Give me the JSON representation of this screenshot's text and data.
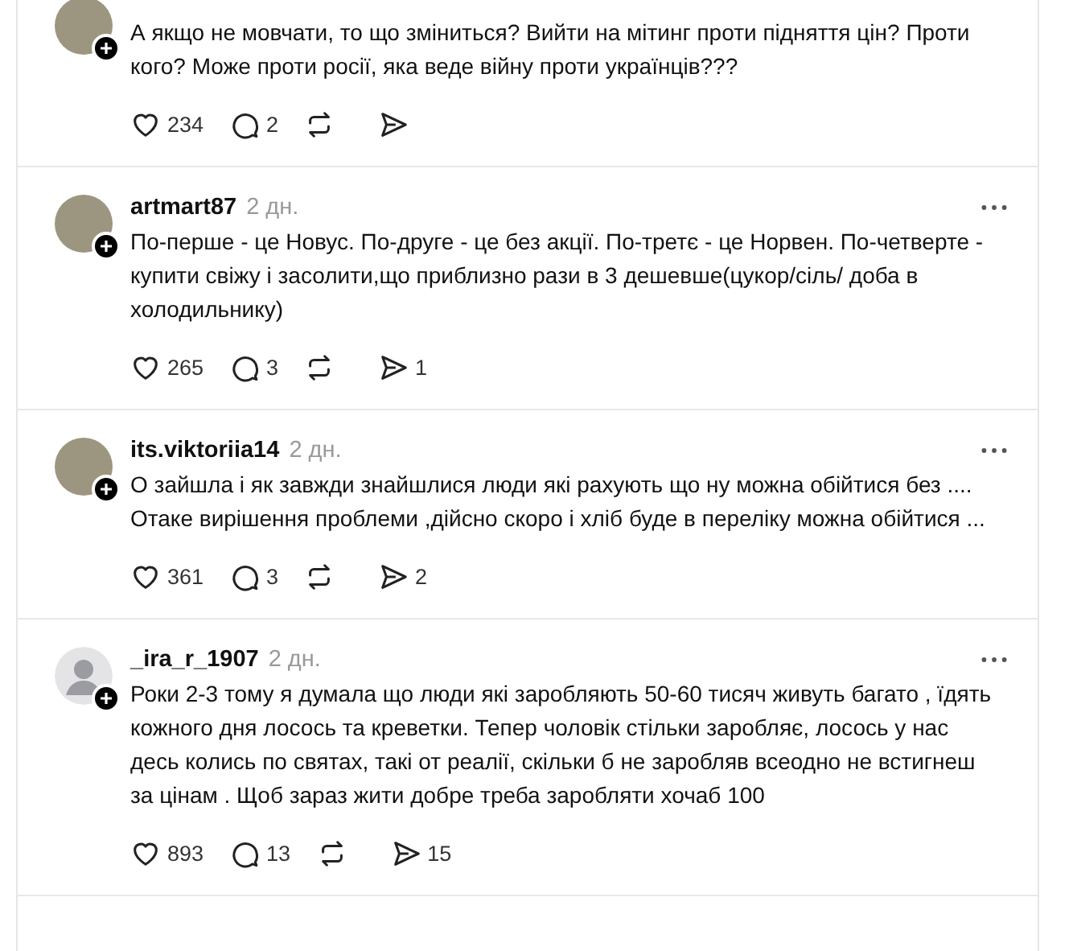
{
  "posts": [
    {
      "photo": true,
      "text": "А якщо не мовчати, то що зміниться? Вийти на мітинг проти підняття цін? Проти кого? Може проти росії, яка веде війну проти українців???",
      "likes": "234",
      "comments": "2"
    },
    {
      "user": "artmart87",
      "time": "2 дн.",
      "photo": true,
      "text": "По-перше - це Новус. По-друге - це без акції. По-третє - це Норвен. По-четверте - купити свіжу і засолити,що приблизно рази в 3 дешевше(цукор/сіль/ доба в холодильнику)",
      "likes": "265",
      "comments": "3",
      "shares": "1"
    },
    {
      "user": "its.viktoriia14",
      "time": "2 дн.",
      "photo": true,
      "text": "О зайшла і як завжди знайшлися люди які рахують що ну можна обійтися без .... Отаке вирішення проблеми ,дійсно скоро і хліб буде в переліку можна обійтися ...",
      "likes": "361",
      "comments": "3",
      "shares": "2"
    },
    {
      "user": "_ira_r_1907",
      "time": "2 дн.",
      "photo": false,
      "text": "Роки 2-3 тому я думала що люди які заробляють 50-60 тисяч живуть багато , їдять кожного дня лосось та креветки. Тепер чоловік стільки заробляє, лосось у нас десь колись по святах, такі от реалії, скільки б не заробляв всеодно не встигнеш за цінам . Щоб зараз жити добре треба заробляти хочаб 100",
      "likes": "893",
      "comments": "13",
      "shares": "15"
    }
  ]
}
